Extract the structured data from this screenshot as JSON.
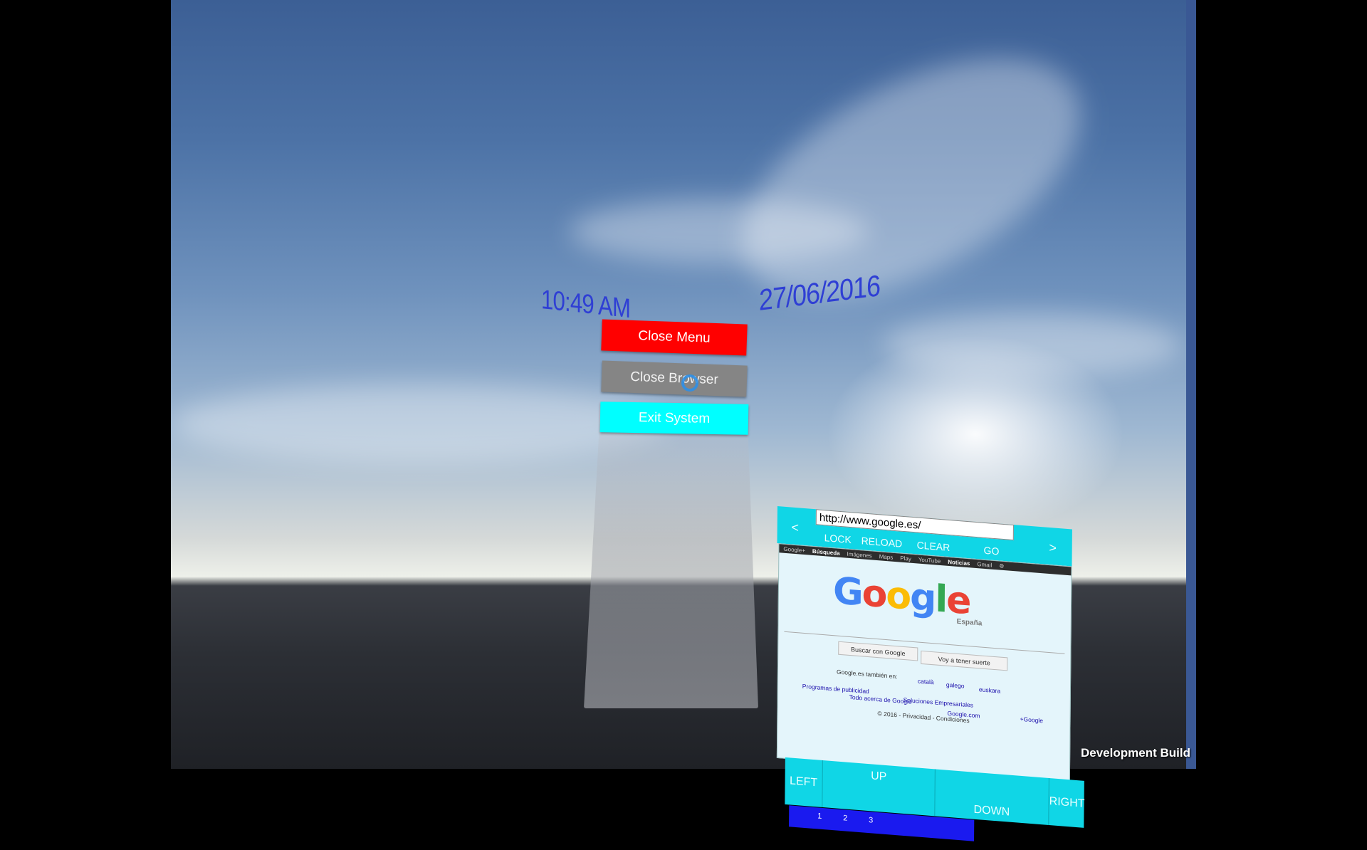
{
  "hud": {
    "time": "10:49 AM",
    "date": "27/06/2016"
  },
  "menu": {
    "close_menu": "Close Menu",
    "close_browser": "Close Browser",
    "exit_system": "Exit System"
  },
  "browser": {
    "back": "<",
    "forward": ">",
    "url": "http://www.google.es/",
    "lock": "LOCK",
    "reload": "RELOAD",
    "clear": "CLEAR",
    "go": "GO",
    "page": {
      "topbar": [
        "Google+",
        "Búsqueda",
        "Imágenes",
        "Maps",
        "Play",
        "YouTube",
        "Noticias",
        "Gmail"
      ],
      "logo": [
        "G",
        "o",
        "o",
        "g",
        "l",
        "e"
      ],
      "logo_colors": [
        "#4285f4",
        "#ea4335",
        "#fbbc05",
        "#4285f4",
        "#34a853",
        "#ea4335"
      ],
      "logo_sub": "España",
      "search_button": "Buscar con Google",
      "lucky_button": "Voy a tener suerte",
      "offered_in": "Google.es también en:",
      "languages": [
        "català",
        "galego",
        "euskara"
      ],
      "ads": "Programas de publicidad",
      "business": "Soluciones Empresariales",
      "plus": "+Google",
      "about": "Todo acerca de Google",
      "google_com": "Google.com",
      "footer": "© 2016 - Privacidad - Condiciones"
    },
    "keys": {
      "left": "LEFT",
      "up": "UP",
      "down": "DOWN",
      "right": "RIGHT"
    },
    "numbers": [
      "1",
      "2",
      "3"
    ]
  },
  "watermark": "Development Build"
}
